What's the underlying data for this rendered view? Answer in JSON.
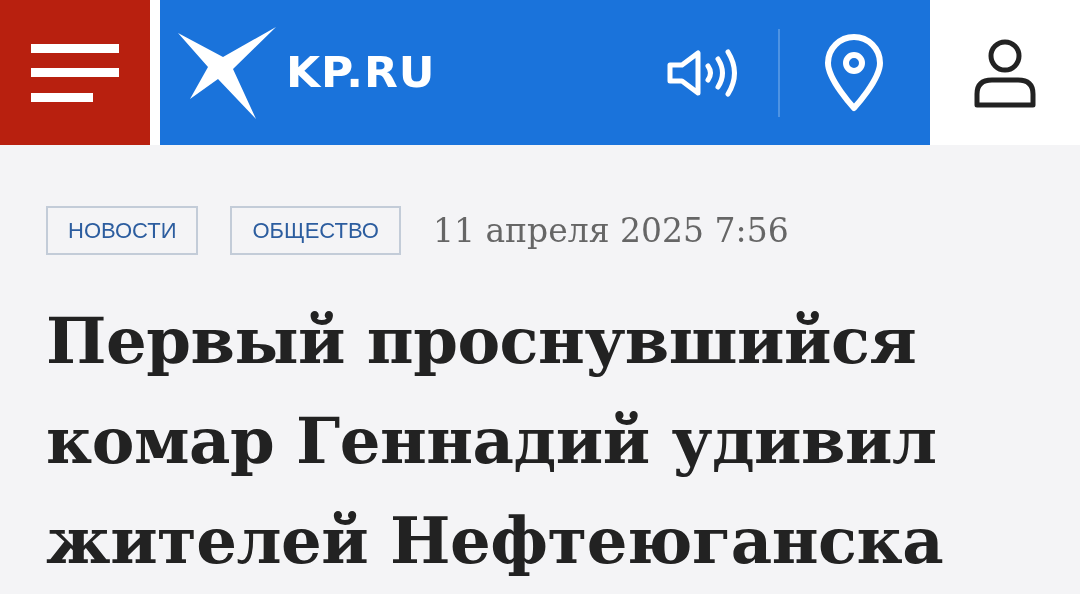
{
  "header": {
    "logo_text": "KP.RU"
  },
  "tags": [
    {
      "label": "НОВОСТИ"
    },
    {
      "label": "ОБЩЕСТВО"
    }
  ],
  "date": "11 апреля 2025 7:56",
  "headline": "Первый проснувшийся комар Геннадий удивил жителей Нефтеюганска"
}
